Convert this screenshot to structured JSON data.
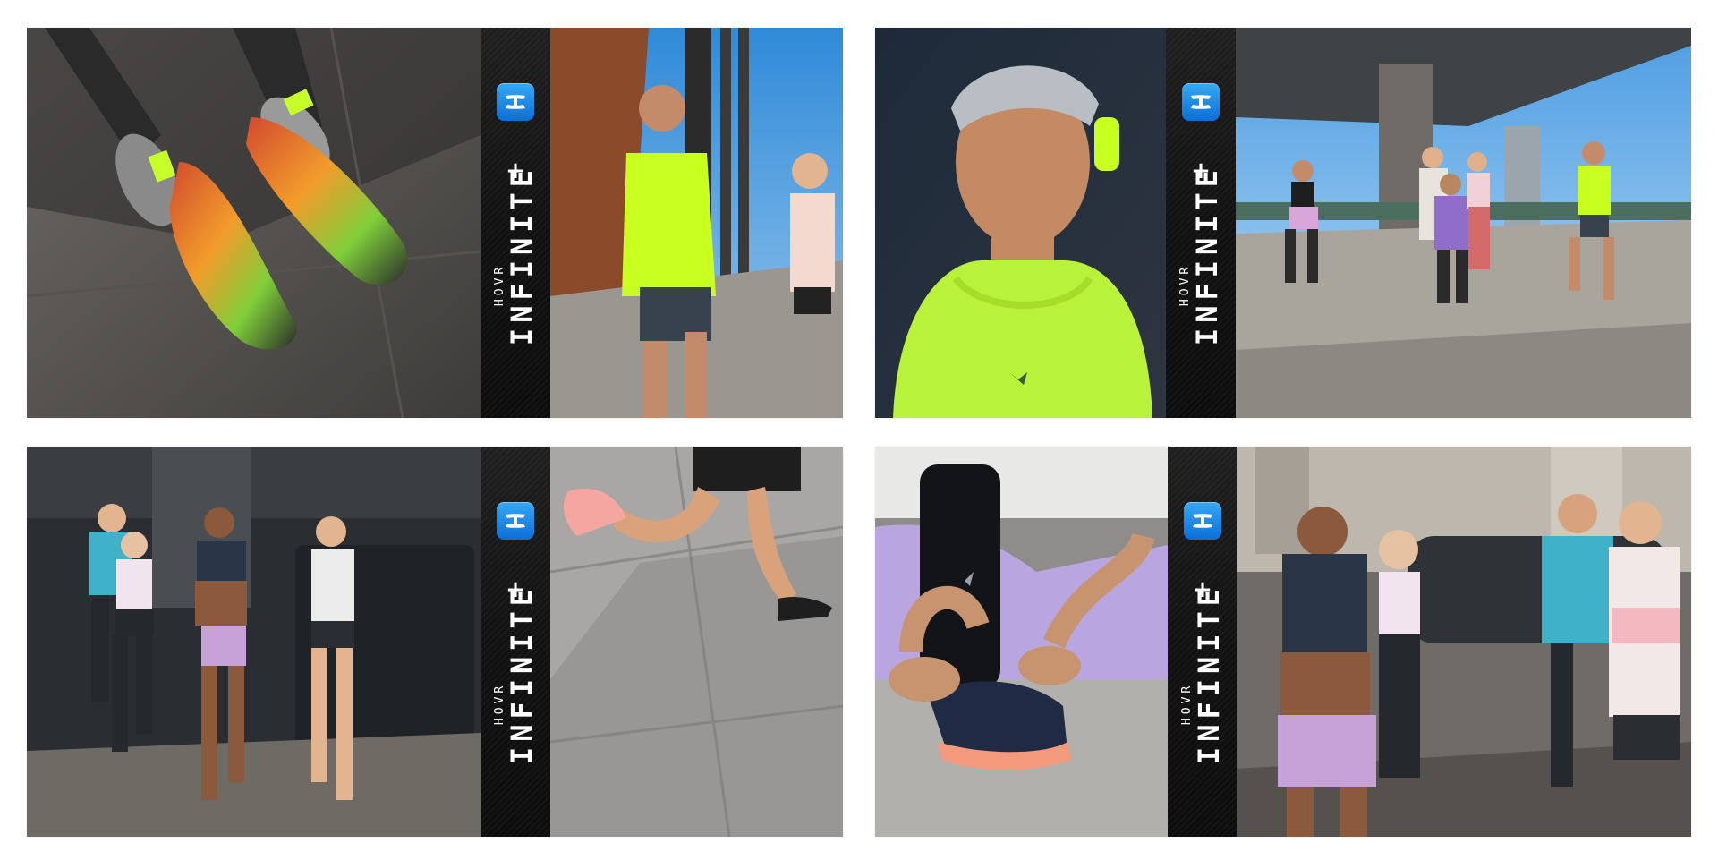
{
  "brand": {
    "line1": "HOVR",
    "line2": "INFINITE",
    "suffix": "+",
    "badge_icon": "under-armour-logo-icon",
    "badge_color": "#1a86e8"
  },
  "panels": [
    {
      "left_photo": "shoes-on-pavement-photo",
      "right_photo": "runners-on-bridge-photo"
    },
    {
      "left_photo": "runner-portrait-photo",
      "right_photo": "group-running-under-overpass-photo"
    },
    {
      "left_photo": "group-running-street-photo",
      "right_photo": "running-legs-sidewalk-photo"
    },
    {
      "left_photo": "tying-shoe-photo",
      "right_photo": "group-running-city-photo"
    }
  ]
}
